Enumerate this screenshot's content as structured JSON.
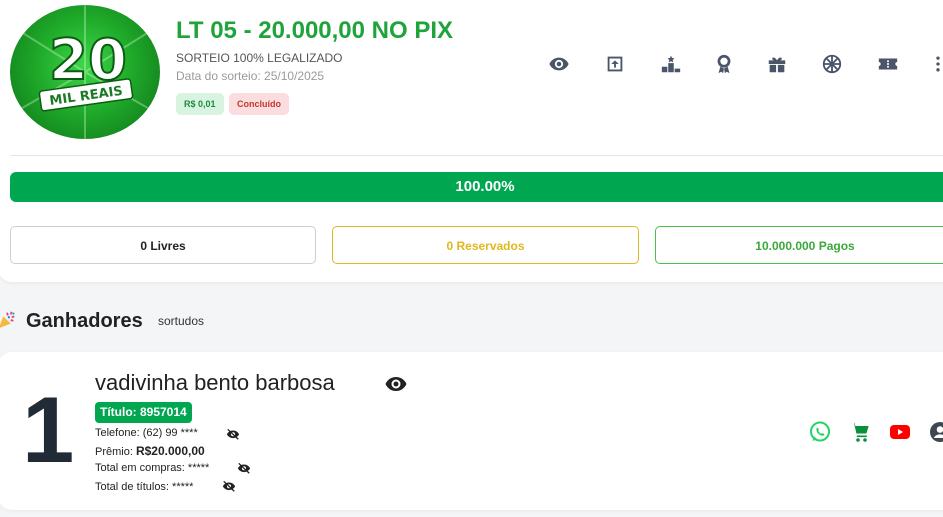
{
  "raffle": {
    "logo_text_top": "20",
    "logo_text_bottom": "MIL REAIS",
    "title": "LT 05 - 20.000,00 NO PIX",
    "subtitle": "SORTEIO 100% LEGALIZADO",
    "draw_date": "Data do sorteio: 25/10/2025",
    "price_badge": "R$ 0,01",
    "status_badge": "Concluído"
  },
  "toolbar": {
    "icons": [
      "eye-icon",
      "share-icon",
      "podium-icon",
      "award-icon",
      "gift-icon",
      "wheel-icon",
      "ticket-icon",
      "more-icon"
    ]
  },
  "progress": {
    "percent": 100,
    "label": "100.00%",
    "color": "#00a650"
  },
  "stats": {
    "free": "0 Livres",
    "reserved": "0 Reservados",
    "paid": "10.000.000 Pagos"
  },
  "winners": {
    "heading": "Ganhadores",
    "subheading": "sortudos",
    "items": [
      {
        "rank": "1",
        "name": "vadivinha bento barbosa",
        "ticket": "Título: 8957014",
        "phone": "Telefone: (62) 99 ****",
        "prize_label": "Prêmio:",
        "prize_value": "R$20.000,00",
        "total_purchases": "Total em compras: *****",
        "total_tickets": "Total de títulos: *****"
      }
    ]
  },
  "colors": {
    "brand_green": "#1fa43c",
    "progress_green": "#00a650",
    "whatsapp": "#25d366",
    "youtube": "#ff0000",
    "reserved_yellow": "#e0b820"
  }
}
